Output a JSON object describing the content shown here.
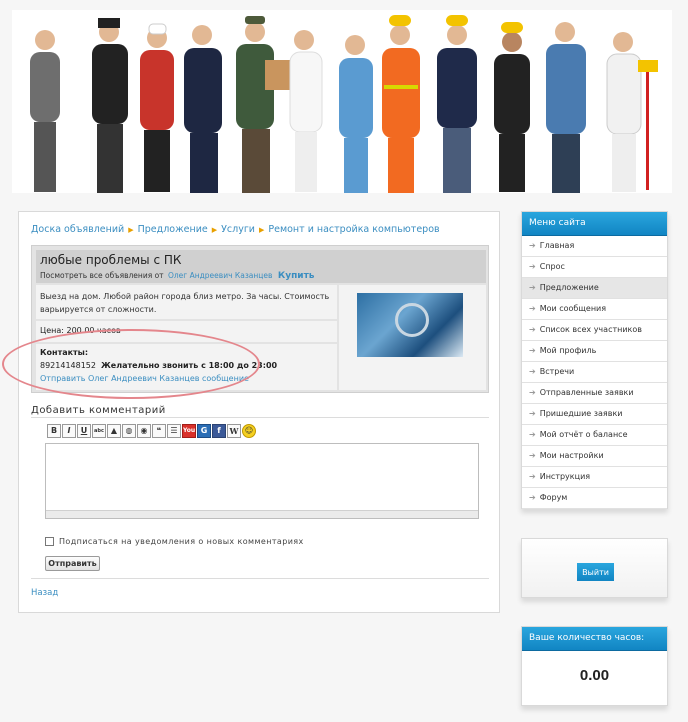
{
  "breadcrumb": [
    "Доска объявлений",
    "Предложение",
    "Услуги",
    "Ремонт и настройка компьютеров"
  ],
  "ad": {
    "title": "любые проблемы с ПК",
    "sub_prefix": "Посмотреть все объявления от",
    "author": "Олег Андреевич Казанцев",
    "buy": "Купить",
    "description": "Выезд на дом. Любой район города близ метро. За часы. Стоимость варьируется от сложности.",
    "price": "Цена: 200.00 часов",
    "contacts_label": "Контакты:",
    "phone": "89214148152",
    "call_time": "Желательно звонить с 18:00 до 23:00",
    "message_link": "Отправить Олег Андреевич Казанцев сообщение"
  },
  "comments": {
    "title": "Добавить комментарий",
    "toolbar": [
      "B",
      "I",
      "U",
      "abc",
      "img",
      "url",
      "eye",
      "quote",
      "list",
      "YouTube",
      "G",
      "f",
      "W",
      "smile"
    ],
    "subscribe_label": "Подписаться на уведомления о новых комментариях",
    "send_label": "Отправить",
    "back_label": "Назад"
  },
  "sidebar": {
    "menu_title": "Меню сайта",
    "items": [
      {
        "label": "Главная"
      },
      {
        "label": "Спрос"
      },
      {
        "label": "Предложение",
        "active": true
      },
      {
        "label": "Мои сообщения"
      },
      {
        "label": "Список всех участников"
      },
      {
        "label": "Мой профиль"
      },
      {
        "label": "Встречи"
      },
      {
        "label": "Отправленные заявки"
      },
      {
        "label": "Пришедшие заявки"
      },
      {
        "label": "Мой отчёт о балансе"
      },
      {
        "label": "Мои настройки"
      },
      {
        "label": "Инструкция"
      },
      {
        "label": "Форум"
      }
    ],
    "logout_label": "Выйти",
    "hours_title": "Ваше количество часов:",
    "hours_value": "0.00"
  },
  "colors": {
    "accent": "#1c95d0",
    "link": "#3b8ec1",
    "highlight_oval": "#e4868c"
  }
}
